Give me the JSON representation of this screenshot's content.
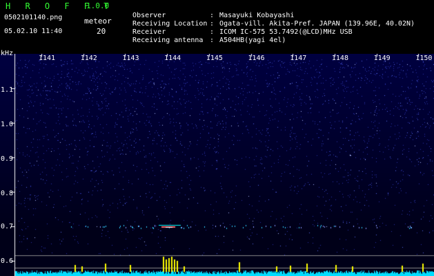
{
  "header": {
    "app_name": "H R O F F T",
    "app_version": "1.0.0",
    "file_name": "0502101140.png",
    "date_time": "05.02.10 11:40",
    "meteor_label": "meteor",
    "meteor_count": "20",
    "info": [
      {
        "key": "Observer",
        "sep": ":",
        "value": "Masayuki Kobayashi"
      },
      {
        "key": "Receiving Location",
        "sep": ":",
        "value": "Ogata-vill. Akita-Pref. JAPAN (139.96E, 40.02N)"
      },
      {
        "key": "Receiver",
        "sep": ":",
        "value": "ICOM IC-575 53.7492(@LCD)MHz USB"
      },
      {
        "key": "Receiving antenna",
        "sep": ":",
        "value": "A504HB(yagi 4el)"
      }
    ]
  },
  "plot": {
    "y_unit": "kHz",
    "y_ticks": [
      "1.1",
      "1.0",
      "0.9",
      "0.8",
      "0.7",
      "0.6"
    ],
    "time_ticks": [
      "1141",
      "1142",
      "1143",
      "1144",
      "1145",
      "1146",
      "1147",
      "1148",
      "1149",
      "1150"
    ],
    "colors": {
      "background": "#000040",
      "noise": "#6677ff",
      "signal": "#ffff00",
      "baseline": "#00ffff"
    }
  }
}
